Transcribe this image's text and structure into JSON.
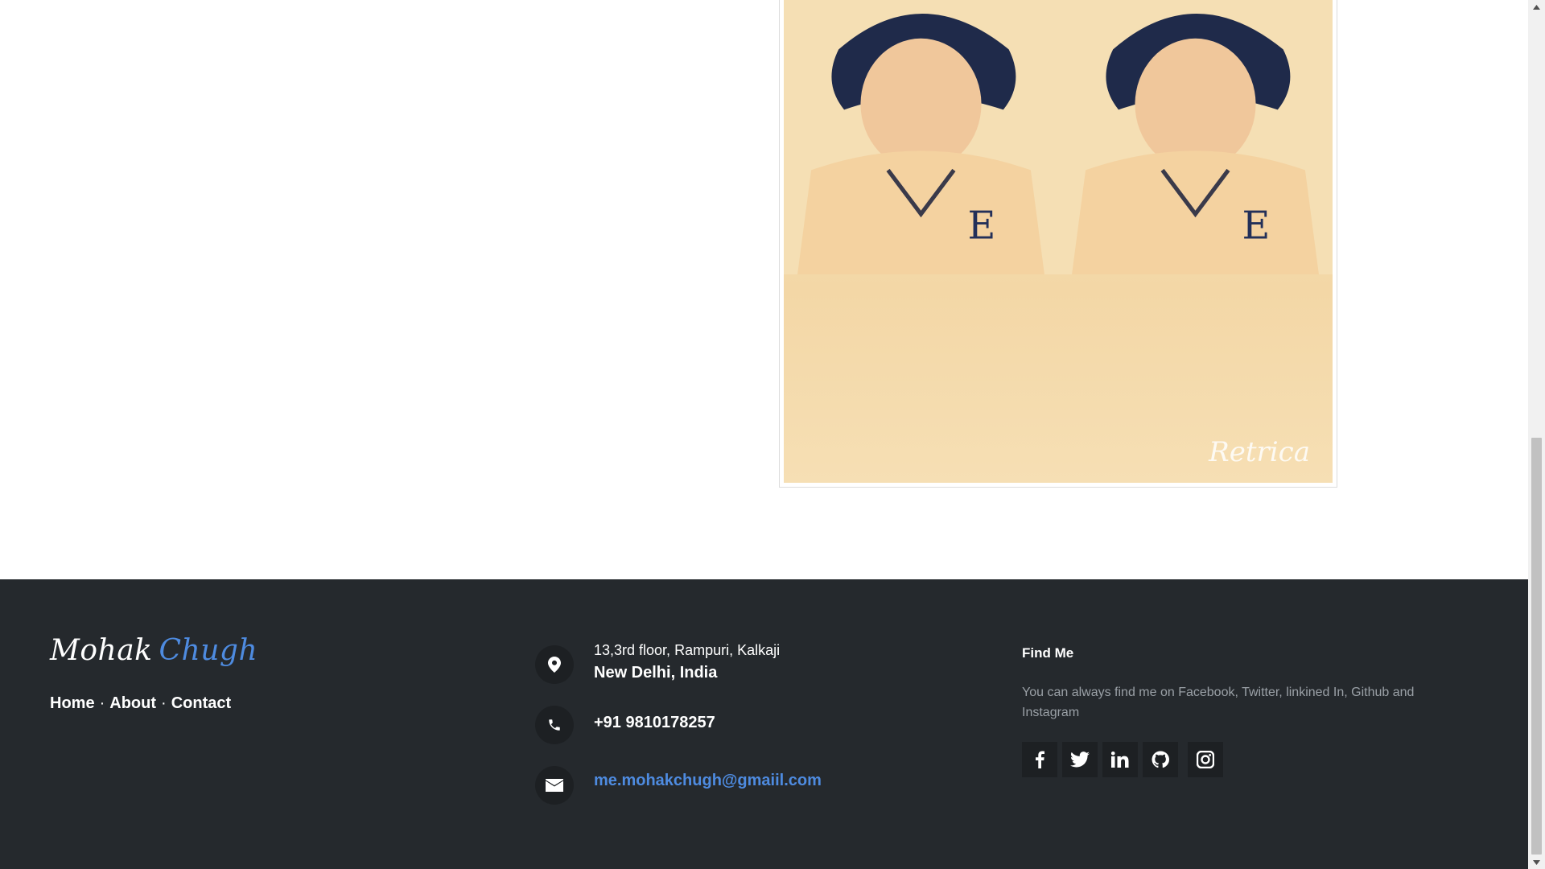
{
  "photo": {
    "watermark": "Retrica",
    "alt": "profile photo"
  },
  "footer": {
    "brand_first": "Mohak",
    "brand_last": "Chugh",
    "nav": {
      "home": "Home",
      "about": "About",
      "contact": "Contact",
      "separator": "·"
    },
    "address_line1": "13,3rd floor, Rampuri, Kalkaji",
    "address_line2": "New Delhi, India",
    "phone": "+91 9810178257",
    "email": "me.mohakchugh@gmaiil.com",
    "find_me_title": "Find Me",
    "find_me_text": "You can always find me on Facebook, Twitter, linkined In, Github and Instagram",
    "social_icons": [
      "facebook-icon",
      "twitter-icon",
      "linkedin-icon",
      "github-icon",
      "instagram-icon"
    ]
  },
  "colors": {
    "footer_bg": "#25292d",
    "icon_bg": "#1d2023",
    "accent": "#4e8be0",
    "muted_text": "#9aa0a6"
  }
}
